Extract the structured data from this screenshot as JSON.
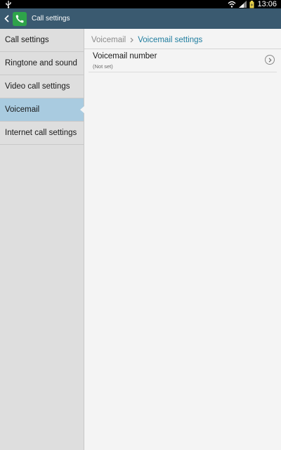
{
  "status_bar": {
    "time": "13:06"
  },
  "action_bar": {
    "title": "Call settings"
  },
  "sidebar": {
    "items": [
      {
        "label": "Call settings"
      },
      {
        "label": "Ringtone and sound"
      },
      {
        "label": "Video call settings"
      },
      {
        "label": "Voicemail",
        "selected": true
      },
      {
        "label": "Internet call settings"
      }
    ]
  },
  "main": {
    "breadcrumb": {
      "parent": "Voicemail",
      "current": "Voicemail settings"
    },
    "settings": [
      {
        "title": "Voicemail number",
        "subtitle": "(Not set)"
      }
    ]
  },
  "colors": {
    "action_bar": "#3a5a70",
    "selected_item": "#a9cbe0",
    "breadcrumb_current": "#1f7d9f",
    "app_icon": "#2ea34a"
  }
}
